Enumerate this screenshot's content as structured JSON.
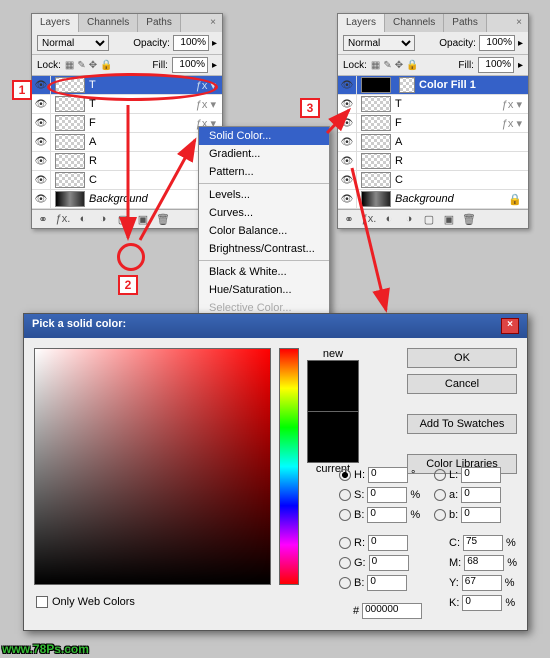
{
  "panel1": {
    "tabs": [
      "Layers",
      "Channels",
      "Paths"
    ],
    "blend": "Normal",
    "opacity_label": "Opacity:",
    "opacity": "100%",
    "lock": "Lock:",
    "fill_label": "Fill:",
    "fill": "100%",
    "layers": [
      "T",
      "T",
      "F",
      "A",
      "R",
      "C",
      "Background"
    ]
  },
  "panel2": {
    "tabs": [
      "Layers",
      "Channels",
      "Paths"
    ],
    "blend": "Normal",
    "opacity_label": "Opacity:",
    "opacity": "100%",
    "lock": "Lock:",
    "fill_label": "Fill:",
    "fill": "100%",
    "sel": "Color Fill 1",
    "layers": [
      "T",
      "F",
      "A",
      "R",
      "C",
      "Background"
    ]
  },
  "menu": {
    "items": [
      "Solid Color...",
      "Gradient...",
      "Pattern...",
      "Levels...",
      "Curves...",
      "Color Balance...",
      "Brightness/Contrast...",
      "Black & White...",
      "Hue/Saturation...",
      "Selective Color..."
    ]
  },
  "step": {
    "1": "1",
    "2": "2",
    "3": "3"
  },
  "dlg": {
    "title": "Pick a solid color:",
    "new": "new",
    "current": "current",
    "ok": "OK",
    "cancel": "Cancel",
    "add": "Add To Swatches",
    "lib": "Color Libraries",
    "H": "H:",
    "S": "S:",
    "Bv": "B:",
    "R": "R:",
    "G": "G:",
    "B2": "B:",
    "L": "L:",
    "a": "a:",
    "b": "b:",
    "C": "C:",
    "M": "M:",
    "Y": "Y:",
    "K": "K:",
    "deg": "°",
    "pct": "%",
    "hash": "#",
    "hex": "000000",
    "vH": "0",
    "vS": "0",
    "vBv": "0",
    "vR": "0",
    "vG": "0",
    "vB2": "0",
    "vL": "0",
    "va": "0",
    "vb": "0",
    "vC": "75",
    "vM": "68",
    "vY": "67",
    "vK": "0",
    "only": "Only Web Colors"
  },
  "wm": "www.78Ps.com"
}
